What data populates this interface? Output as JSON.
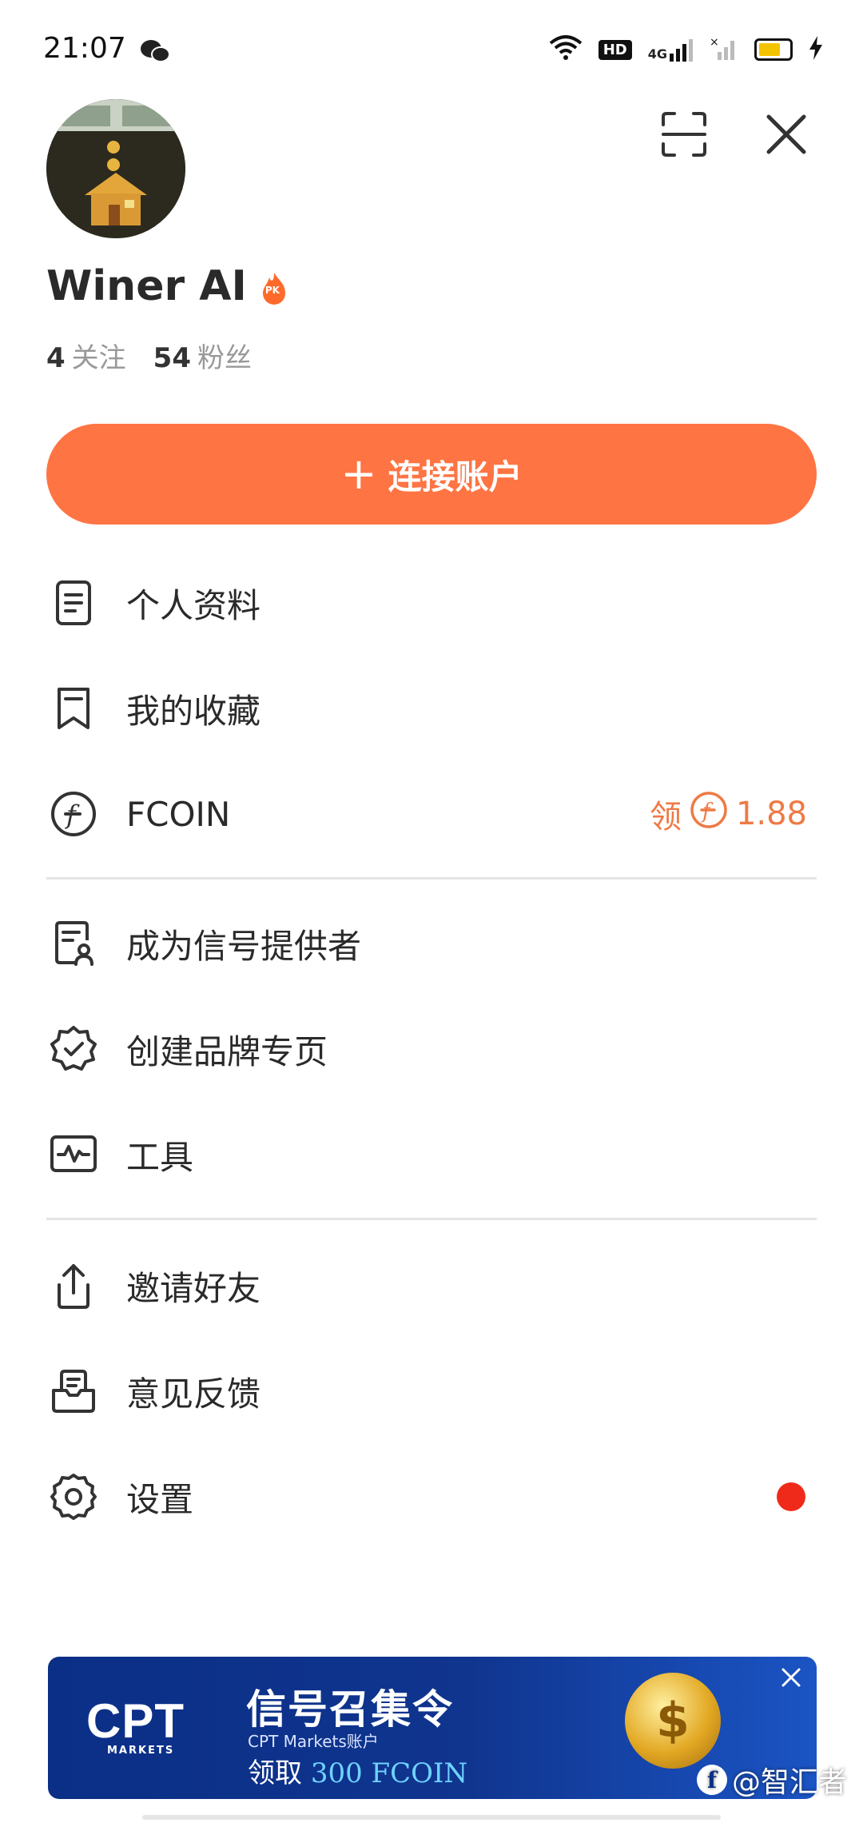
{
  "status_bar": {
    "time": "21:07",
    "hd_label": "HD",
    "network_label": "4G"
  },
  "profile": {
    "name": "Winer AI",
    "badge_label": "PK",
    "following_count": "4",
    "following_label": "关注",
    "followers_count": "54",
    "followers_label": "粉丝"
  },
  "connect_button": {
    "label": "连接账户"
  },
  "menu": {
    "profile": "个人资料",
    "favorites": "我的收藏",
    "fcoin": "FCOIN",
    "fcoin_claim_label": "领",
    "fcoin_amount": "1.88",
    "become_signal_provider": "成为信号提供者",
    "create_brand_page": "创建品牌专页",
    "tools": "工具",
    "invite_friends": "邀请好友",
    "feedback": "意见反馈",
    "settings": "设置"
  },
  "banner": {
    "logo_text": "CPT",
    "logo_sub": "MARKETS",
    "title": "信号召集令",
    "subtitle": "CPT Markets账户",
    "cta_prefix": "领取",
    "cta_amount": "300 FCOIN",
    "coin_glyph": "$"
  },
  "watermark": {
    "text": "@智汇者"
  },
  "colors": {
    "accent": "#ff7443",
    "fcoin_text": "#ee7a45",
    "settings_dot": "#f02a1a",
    "banner_bg": "#0b2f86"
  }
}
